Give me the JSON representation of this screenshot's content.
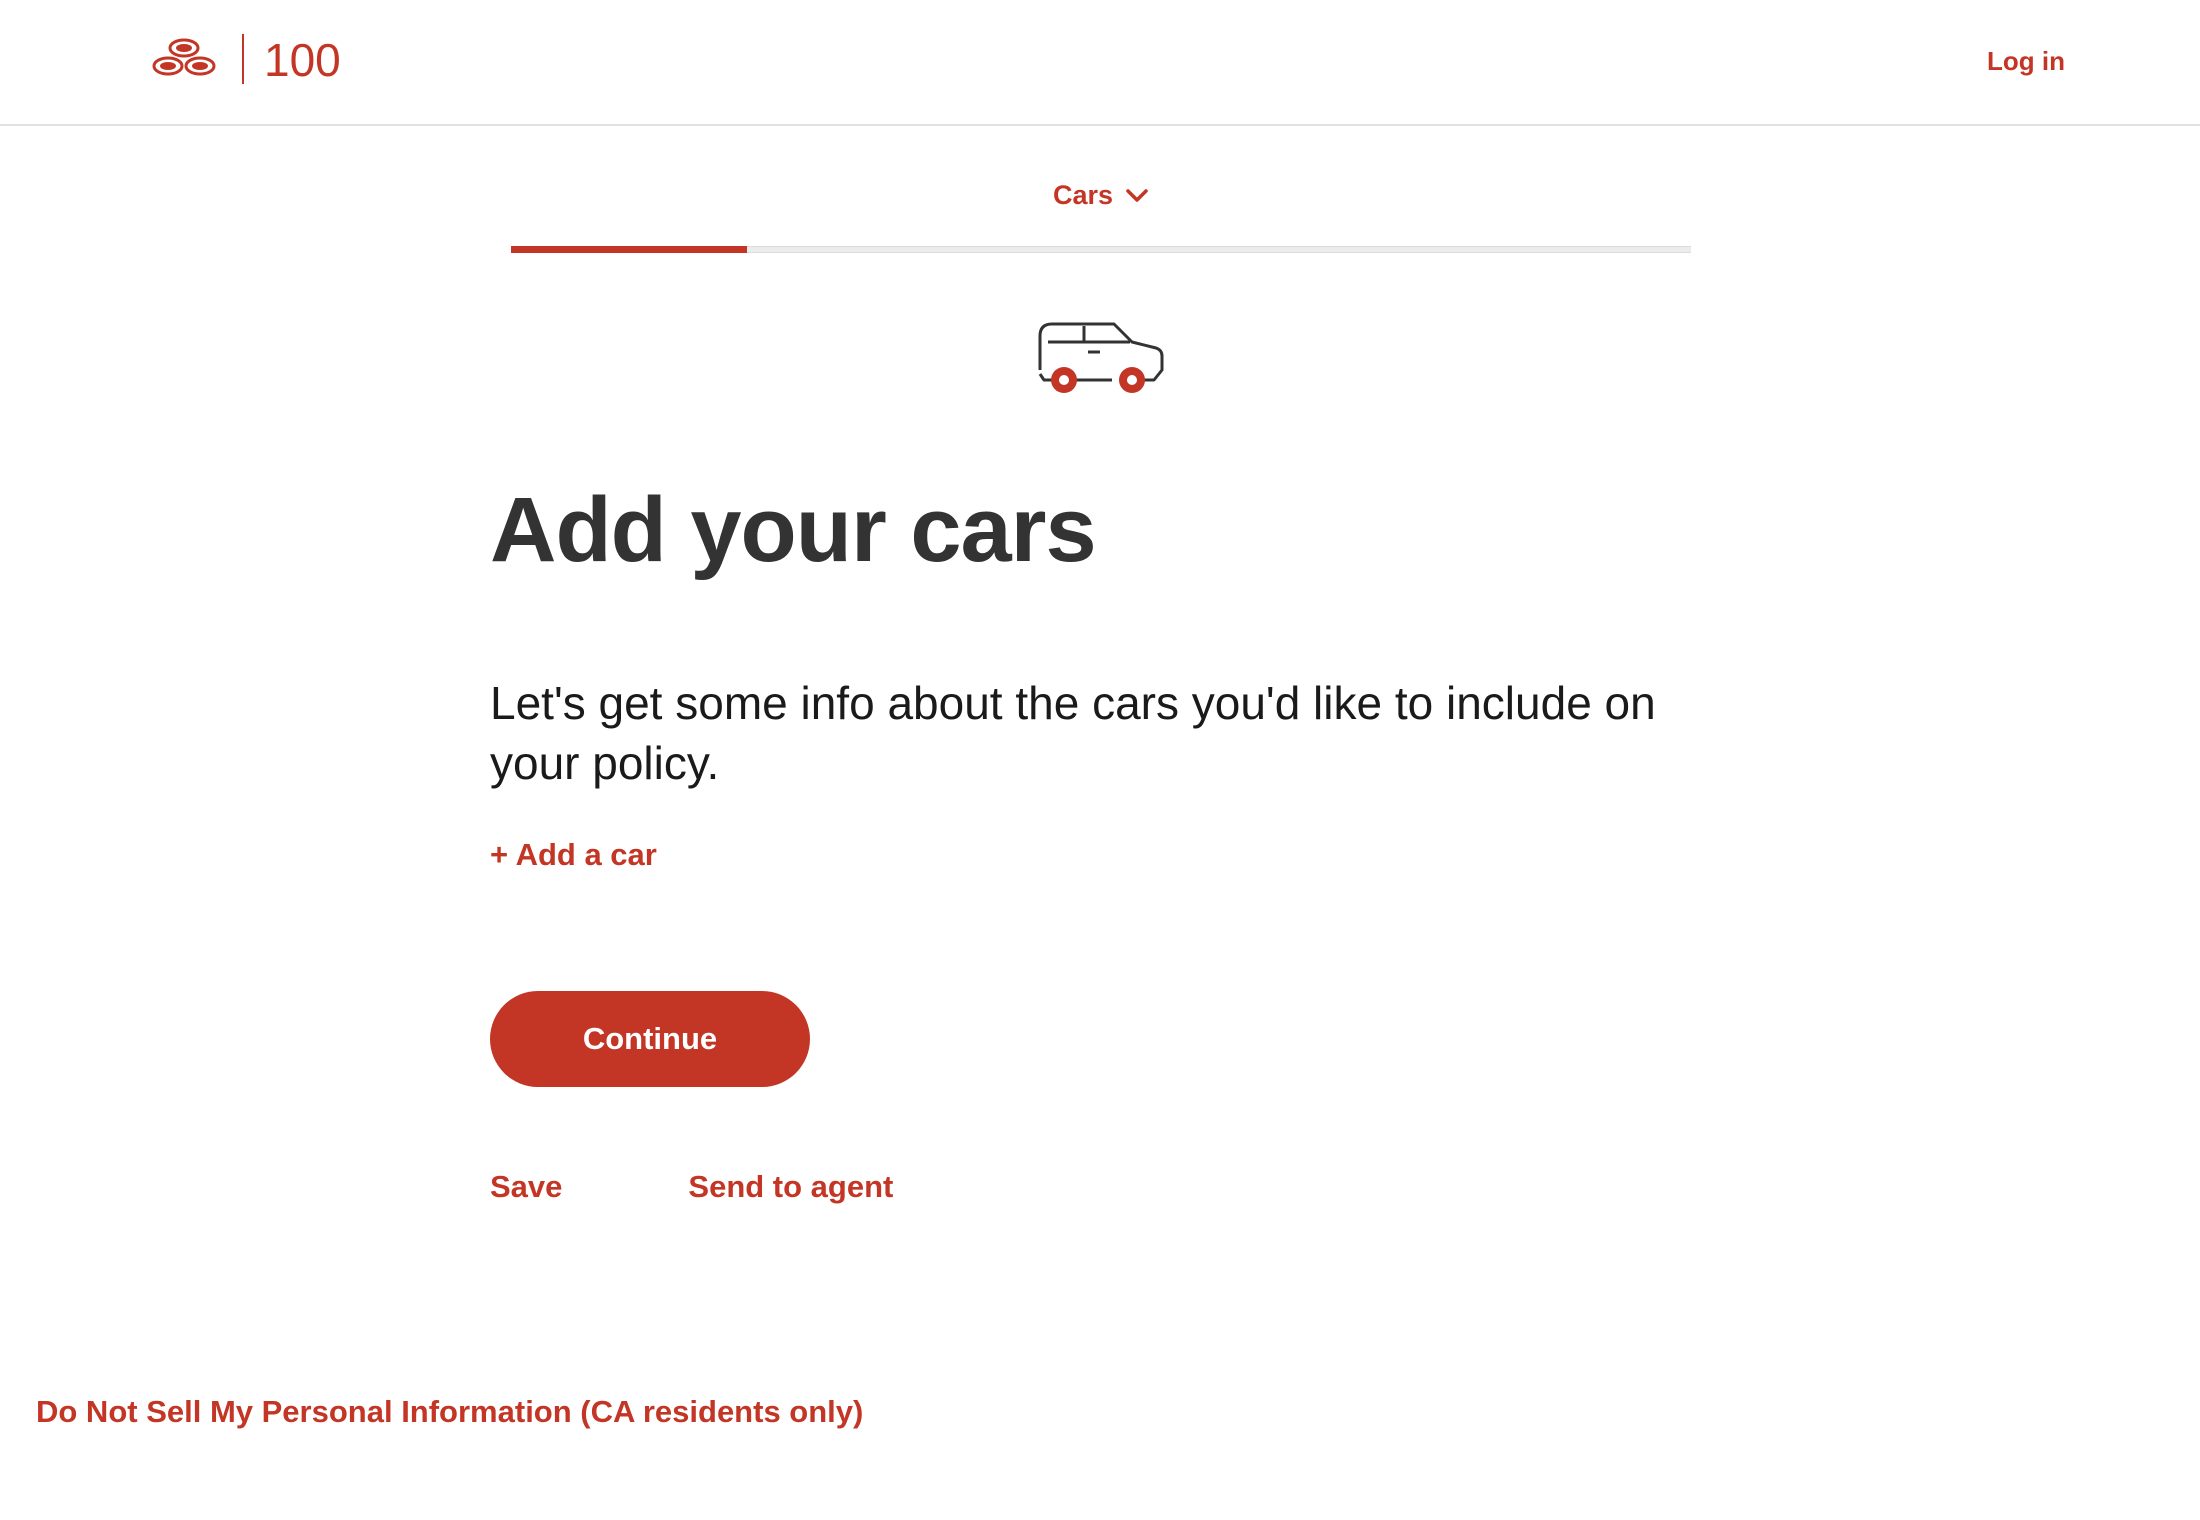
{
  "header": {
    "logo_icon": "three-ovals-logo-icon",
    "logo_text": "100",
    "login_label": "Log in"
  },
  "progress": {
    "section_label": "Cars",
    "section_icon": "chevron-down-icon",
    "fraction": 0.2
  },
  "main": {
    "illustration_icon": "car-icon",
    "title": "Add your cars",
    "intro": "Let's get some info about the cars you'd like to include on your policy.",
    "add_car_label": "+ Add a car",
    "continue_label": "Continue",
    "save_label": "Save",
    "send_to_agent_label": "Send to agent"
  },
  "footer": {
    "privacy_link": "Do Not Sell My Personal Information (CA residents only)"
  },
  "colors": {
    "brand_red": "#c33626",
    "title_text": "#333333",
    "body_text": "#1a1a1a",
    "divider": "#e2e2e2"
  }
}
